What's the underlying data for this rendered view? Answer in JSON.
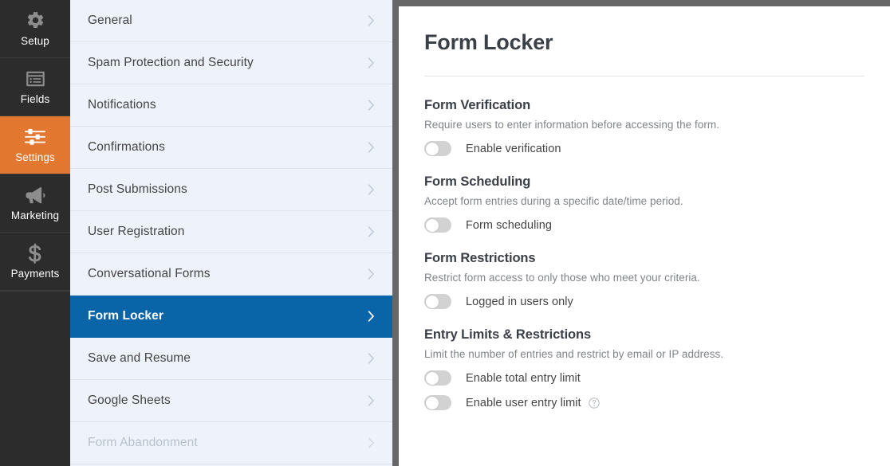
{
  "rail": {
    "items": [
      {
        "label": "Setup",
        "icon": "gear-icon",
        "active": false
      },
      {
        "label": "Fields",
        "icon": "form-list-icon",
        "active": false
      },
      {
        "label": "Settings",
        "icon": "sliders-icon",
        "active": true
      },
      {
        "label": "Marketing",
        "icon": "megaphone-icon",
        "active": false
      },
      {
        "label": "Payments",
        "icon": "dollar-icon",
        "active": false
      }
    ],
    "active_color": "#e27730",
    "background_color": "#2c2c2c"
  },
  "settings_menu": {
    "chevron_icon": "chevron-right-icon",
    "active_color": "#0a65a8",
    "items": [
      {
        "label": "General",
        "active": false,
        "disabled": false
      },
      {
        "label": "Spam Protection and Security",
        "active": false,
        "disabled": false
      },
      {
        "label": "Notifications",
        "active": false,
        "disabled": false
      },
      {
        "label": "Confirmations",
        "active": false,
        "disabled": false
      },
      {
        "label": "Post Submissions",
        "active": false,
        "disabled": false
      },
      {
        "label": "User Registration",
        "active": false,
        "disabled": false
      },
      {
        "label": "Conversational Forms",
        "active": false,
        "disabled": false
      },
      {
        "label": "Form Locker",
        "active": true,
        "disabled": false
      },
      {
        "label": "Save and Resume",
        "active": false,
        "disabled": false
      },
      {
        "label": "Google Sheets",
        "active": false,
        "disabled": false
      },
      {
        "label": "Form Abandonment",
        "active": false,
        "disabled": true
      }
    ]
  },
  "content": {
    "title": "Form Locker",
    "sections": [
      {
        "title": "Form Verification",
        "desc": "Require users to enter information before accessing the form.",
        "toggles": [
          {
            "label": "Enable verification",
            "on": false,
            "help": false
          }
        ]
      },
      {
        "title": "Form Scheduling",
        "desc": "Accept form entries during a specific date/time period.",
        "toggles": [
          {
            "label": "Form scheduling",
            "on": false,
            "help": false
          }
        ]
      },
      {
        "title": "Form Restrictions",
        "desc": "Restrict form access to only those who meet your criteria.",
        "toggles": [
          {
            "label": "Logged in users only",
            "on": false,
            "help": false
          }
        ]
      },
      {
        "title": "Entry Limits & Restrictions",
        "desc": "Limit the number of entries and restrict by email or IP address.",
        "toggles": [
          {
            "label": "Enable total entry limit",
            "on": false,
            "help": false
          },
          {
            "label": "Enable user entry limit",
            "on": false,
            "help": true
          }
        ]
      }
    ]
  }
}
